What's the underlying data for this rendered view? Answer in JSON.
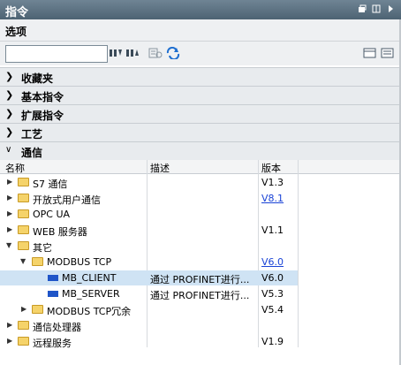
{
  "panel": {
    "title": "指令",
    "options_title": "选项"
  },
  "search": {
    "value": "",
    "placeholder": ""
  },
  "sections": [
    {
      "label": "收藏夹",
      "expanded": false
    },
    {
      "label": "基本指令",
      "expanded": false
    },
    {
      "label": "扩展指令",
      "expanded": false
    },
    {
      "label": "工艺",
      "expanded": false
    },
    {
      "label": "通信",
      "expanded": true
    }
  ],
  "columns": {
    "name": "名称",
    "desc": "描述",
    "version": "版本"
  },
  "tree": [
    {
      "name": "S7 通信",
      "desc": "",
      "version": "V1.3",
      "link": false
    },
    {
      "name": "开放式用户通信",
      "desc": "",
      "version": "V8.1",
      "link": true
    },
    {
      "name": "OPC UA",
      "desc": "",
      "version": "",
      "link": false
    },
    {
      "name": "WEB 服务器",
      "desc": "",
      "version": "V1.1",
      "link": false
    },
    {
      "name": "其它",
      "desc": "",
      "version": "",
      "link": false
    },
    {
      "name": "MODBUS TCP",
      "desc": "",
      "version": "V6.0",
      "link": true
    },
    {
      "name": "MB_CLIENT",
      "desc": "通过 PROFINET进行...",
      "version": "V6.0",
      "link": false,
      "selected": true
    },
    {
      "name": "MB_SERVER",
      "desc": "通过 PROFINET进行...",
      "version": "V5.3",
      "link": false
    },
    {
      "name": "MODBUS TCP冗余",
      "desc": "",
      "version": "V5.4",
      "link": false
    },
    {
      "name": "通信处理器",
      "desc": "",
      "version": "",
      "link": false
    },
    {
      "name": "远程服务",
      "desc": "",
      "version": "V1.9",
      "link": false
    }
  ],
  "colors": {
    "titlebar": "#5a6f80",
    "selection": "#cfe3f4",
    "link": "#1a43d6",
    "folder": "#f5d36a",
    "block": "#1f55c8"
  }
}
